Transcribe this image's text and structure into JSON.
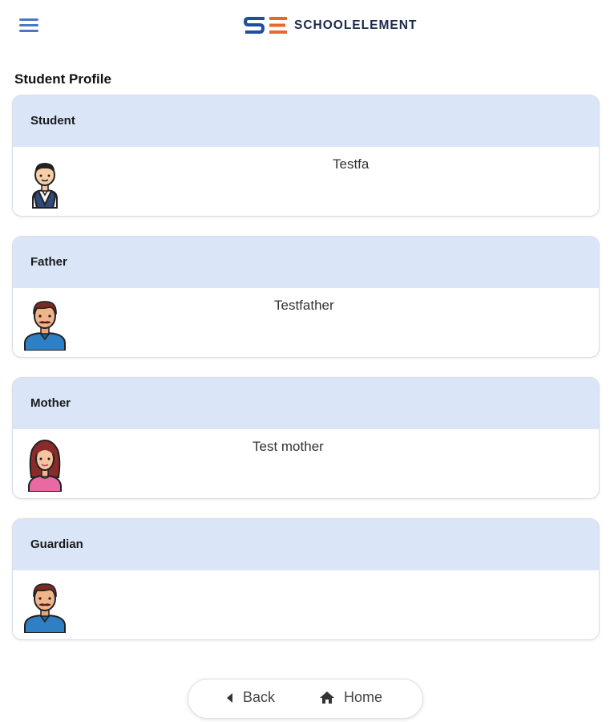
{
  "header": {
    "brand_name": "SCHOOLELEMENT",
    "menu_icon": "hamburger-menu-icon",
    "brand_colors": {
      "s": "#1f4e9c",
      "e": "#e8672a"
    }
  },
  "page": {
    "title": "Student Profile"
  },
  "cards": [
    {
      "heading": "Student",
      "name": "Testfa",
      "avatar": "student-boy-avatar"
    },
    {
      "heading": "Father",
      "name": "Testfather",
      "avatar": "father-avatar"
    },
    {
      "heading": "Mother",
      "name": "Test mother",
      "avatar": "mother-avatar"
    },
    {
      "heading": "Guardian",
      "name": "",
      "avatar": "guardian-avatar"
    }
  ],
  "bottom_nav": {
    "back_label": "Back",
    "home_label": "Home",
    "back_icon": "caret-left-icon",
    "home_icon": "home-icon"
  },
  "colors": {
    "card_header": "#dbe5f8",
    "menu_icon": "#4a78c2"
  }
}
